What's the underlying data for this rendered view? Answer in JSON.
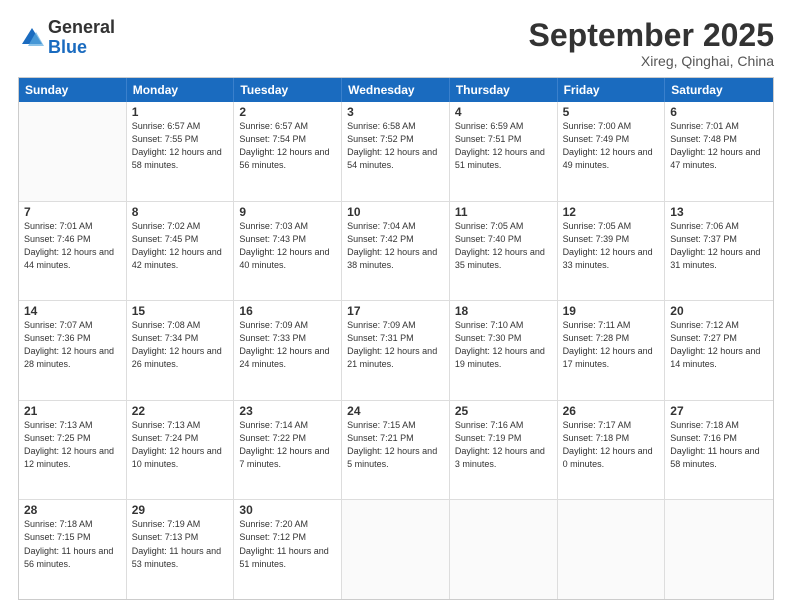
{
  "logo": {
    "general": "General",
    "blue": "Blue"
  },
  "title": "September 2025",
  "location": "Xireg, Qinghai, China",
  "days": [
    "Sunday",
    "Monday",
    "Tuesday",
    "Wednesday",
    "Thursday",
    "Friday",
    "Saturday"
  ],
  "weeks": [
    [
      {
        "day": "",
        "sunrise": "",
        "sunset": "",
        "daylight": ""
      },
      {
        "day": "1",
        "sunrise": "Sunrise: 6:57 AM",
        "sunset": "Sunset: 7:55 PM",
        "daylight": "Daylight: 12 hours and 58 minutes."
      },
      {
        "day": "2",
        "sunrise": "Sunrise: 6:57 AM",
        "sunset": "Sunset: 7:54 PM",
        "daylight": "Daylight: 12 hours and 56 minutes."
      },
      {
        "day": "3",
        "sunrise": "Sunrise: 6:58 AM",
        "sunset": "Sunset: 7:52 PM",
        "daylight": "Daylight: 12 hours and 54 minutes."
      },
      {
        "day": "4",
        "sunrise": "Sunrise: 6:59 AM",
        "sunset": "Sunset: 7:51 PM",
        "daylight": "Daylight: 12 hours and 51 minutes."
      },
      {
        "day": "5",
        "sunrise": "Sunrise: 7:00 AM",
        "sunset": "Sunset: 7:49 PM",
        "daylight": "Daylight: 12 hours and 49 minutes."
      },
      {
        "day": "6",
        "sunrise": "Sunrise: 7:01 AM",
        "sunset": "Sunset: 7:48 PM",
        "daylight": "Daylight: 12 hours and 47 minutes."
      }
    ],
    [
      {
        "day": "7",
        "sunrise": "Sunrise: 7:01 AM",
        "sunset": "Sunset: 7:46 PM",
        "daylight": "Daylight: 12 hours and 44 minutes."
      },
      {
        "day": "8",
        "sunrise": "Sunrise: 7:02 AM",
        "sunset": "Sunset: 7:45 PM",
        "daylight": "Daylight: 12 hours and 42 minutes."
      },
      {
        "day": "9",
        "sunrise": "Sunrise: 7:03 AM",
        "sunset": "Sunset: 7:43 PM",
        "daylight": "Daylight: 12 hours and 40 minutes."
      },
      {
        "day": "10",
        "sunrise": "Sunrise: 7:04 AM",
        "sunset": "Sunset: 7:42 PM",
        "daylight": "Daylight: 12 hours and 38 minutes."
      },
      {
        "day": "11",
        "sunrise": "Sunrise: 7:05 AM",
        "sunset": "Sunset: 7:40 PM",
        "daylight": "Daylight: 12 hours and 35 minutes."
      },
      {
        "day": "12",
        "sunrise": "Sunrise: 7:05 AM",
        "sunset": "Sunset: 7:39 PM",
        "daylight": "Daylight: 12 hours and 33 minutes."
      },
      {
        "day": "13",
        "sunrise": "Sunrise: 7:06 AM",
        "sunset": "Sunset: 7:37 PM",
        "daylight": "Daylight: 12 hours and 31 minutes."
      }
    ],
    [
      {
        "day": "14",
        "sunrise": "Sunrise: 7:07 AM",
        "sunset": "Sunset: 7:36 PM",
        "daylight": "Daylight: 12 hours and 28 minutes."
      },
      {
        "day": "15",
        "sunrise": "Sunrise: 7:08 AM",
        "sunset": "Sunset: 7:34 PM",
        "daylight": "Daylight: 12 hours and 26 minutes."
      },
      {
        "day": "16",
        "sunrise": "Sunrise: 7:09 AM",
        "sunset": "Sunset: 7:33 PM",
        "daylight": "Daylight: 12 hours and 24 minutes."
      },
      {
        "day": "17",
        "sunrise": "Sunrise: 7:09 AM",
        "sunset": "Sunset: 7:31 PM",
        "daylight": "Daylight: 12 hours and 21 minutes."
      },
      {
        "day": "18",
        "sunrise": "Sunrise: 7:10 AM",
        "sunset": "Sunset: 7:30 PM",
        "daylight": "Daylight: 12 hours and 19 minutes."
      },
      {
        "day": "19",
        "sunrise": "Sunrise: 7:11 AM",
        "sunset": "Sunset: 7:28 PM",
        "daylight": "Daylight: 12 hours and 17 minutes."
      },
      {
        "day": "20",
        "sunrise": "Sunrise: 7:12 AM",
        "sunset": "Sunset: 7:27 PM",
        "daylight": "Daylight: 12 hours and 14 minutes."
      }
    ],
    [
      {
        "day": "21",
        "sunrise": "Sunrise: 7:13 AM",
        "sunset": "Sunset: 7:25 PM",
        "daylight": "Daylight: 12 hours and 12 minutes."
      },
      {
        "day": "22",
        "sunrise": "Sunrise: 7:13 AM",
        "sunset": "Sunset: 7:24 PM",
        "daylight": "Daylight: 12 hours and 10 minutes."
      },
      {
        "day": "23",
        "sunrise": "Sunrise: 7:14 AM",
        "sunset": "Sunset: 7:22 PM",
        "daylight": "Daylight: 12 hours and 7 minutes."
      },
      {
        "day": "24",
        "sunrise": "Sunrise: 7:15 AM",
        "sunset": "Sunset: 7:21 PM",
        "daylight": "Daylight: 12 hours and 5 minutes."
      },
      {
        "day": "25",
        "sunrise": "Sunrise: 7:16 AM",
        "sunset": "Sunset: 7:19 PM",
        "daylight": "Daylight: 12 hours and 3 minutes."
      },
      {
        "day": "26",
        "sunrise": "Sunrise: 7:17 AM",
        "sunset": "Sunset: 7:18 PM",
        "daylight": "Daylight: 12 hours and 0 minutes."
      },
      {
        "day": "27",
        "sunrise": "Sunrise: 7:18 AM",
        "sunset": "Sunset: 7:16 PM",
        "daylight": "Daylight: 11 hours and 58 minutes."
      }
    ],
    [
      {
        "day": "28",
        "sunrise": "Sunrise: 7:18 AM",
        "sunset": "Sunset: 7:15 PM",
        "daylight": "Daylight: 11 hours and 56 minutes."
      },
      {
        "day": "29",
        "sunrise": "Sunrise: 7:19 AM",
        "sunset": "Sunset: 7:13 PM",
        "daylight": "Daylight: 11 hours and 53 minutes."
      },
      {
        "day": "30",
        "sunrise": "Sunrise: 7:20 AM",
        "sunset": "Sunset: 7:12 PM",
        "daylight": "Daylight: 11 hours and 51 minutes."
      },
      {
        "day": "",
        "sunrise": "",
        "sunset": "",
        "daylight": ""
      },
      {
        "day": "",
        "sunrise": "",
        "sunset": "",
        "daylight": ""
      },
      {
        "day": "",
        "sunrise": "",
        "sunset": "",
        "daylight": ""
      },
      {
        "day": "",
        "sunrise": "",
        "sunset": "",
        "daylight": ""
      }
    ]
  ]
}
